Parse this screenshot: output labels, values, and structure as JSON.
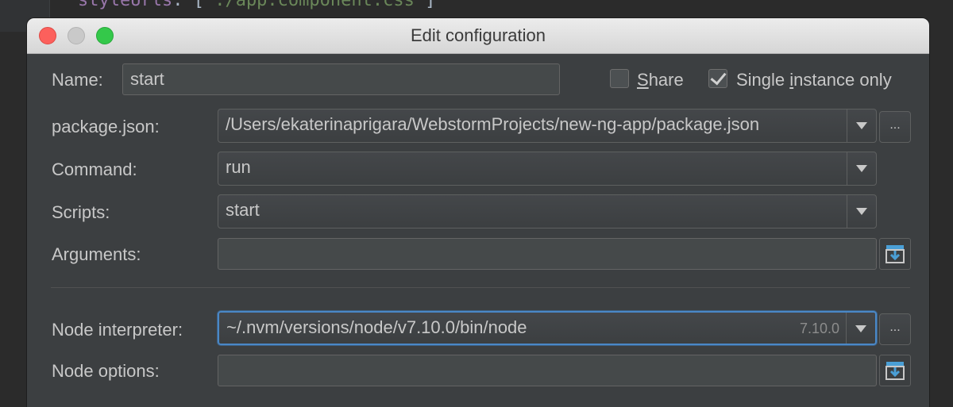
{
  "editor": {
    "line_key": "styleUrls",
    "line_rest": ": ['",
    "line_string": "./app.component.css",
    "line_end": "']"
  },
  "dialog": {
    "title": "Edit configuration"
  },
  "name": {
    "label": "Name:",
    "value": "start"
  },
  "share": {
    "mnemonic": "S",
    "rest": "hare",
    "checked": false
  },
  "single_instance": {
    "pre": "Single ",
    "mnemonic": "i",
    "rest": "nstance only",
    "checked": true
  },
  "package_json": {
    "label": "package.json:",
    "value": "/Users/ekaterinaprigara/WebstormProjects/new-ng-app/package.json",
    "browse": "..."
  },
  "command": {
    "label": "Command:",
    "value": "run"
  },
  "scripts": {
    "label": "Scripts:",
    "value": "start"
  },
  "arguments": {
    "label": "Arguments:",
    "value": ""
  },
  "node_interpreter": {
    "label": "Node interpreter:",
    "value": "~/.nvm/versions/node/v7.10.0/bin/node",
    "version": "7.10.0",
    "browse": "..."
  },
  "node_options": {
    "label": "Node options:",
    "value": ""
  },
  "colors": {
    "accent": "#4a88c7",
    "background": "#3c3f41"
  },
  "icons": [
    "close-window-light",
    "minimize-window-light",
    "maximize-window-light",
    "chevron-down-icon",
    "insert-macro-icon"
  ]
}
